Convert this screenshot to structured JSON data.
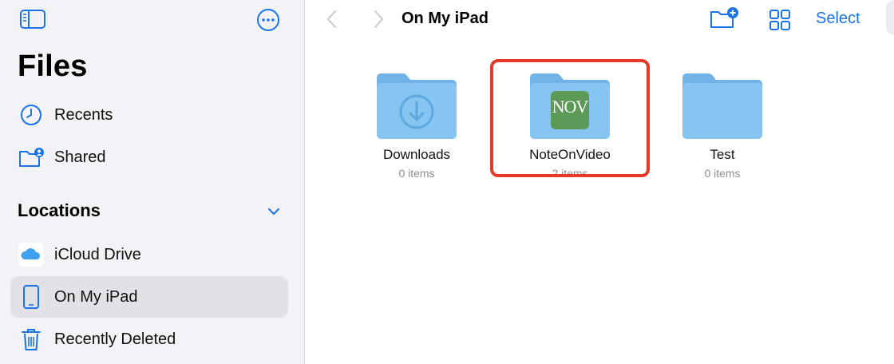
{
  "sidebar": {
    "title": "Files",
    "items": [
      {
        "label": "Recents",
        "icon": "clock-icon"
      },
      {
        "label": "Shared",
        "icon": "shared-folder-icon"
      }
    ],
    "locations_header": "Locations",
    "locations": [
      {
        "label": "iCloud Drive",
        "icon": "icloud-icon"
      },
      {
        "label": "On My iPad",
        "icon": "ipad-icon",
        "selected": true
      },
      {
        "label": "Recently Deleted",
        "icon": "trash-icon"
      }
    ]
  },
  "toolbar": {
    "title": "On My iPad",
    "select_label": "Select"
  },
  "folders": [
    {
      "name": "Downloads",
      "count": "0 items"
    },
    {
      "name": "NoteOnVideo",
      "count": "2 items",
      "app_icon_text": "NOV"
    },
    {
      "name": "Test",
      "count": "0 items"
    }
  ],
  "colors": {
    "accent": "#1a73e8",
    "folder_body": "#86c5f2",
    "folder_tab": "#6fb3e8",
    "highlight": "#e5392a",
    "app_icon": "#5e9a57"
  }
}
